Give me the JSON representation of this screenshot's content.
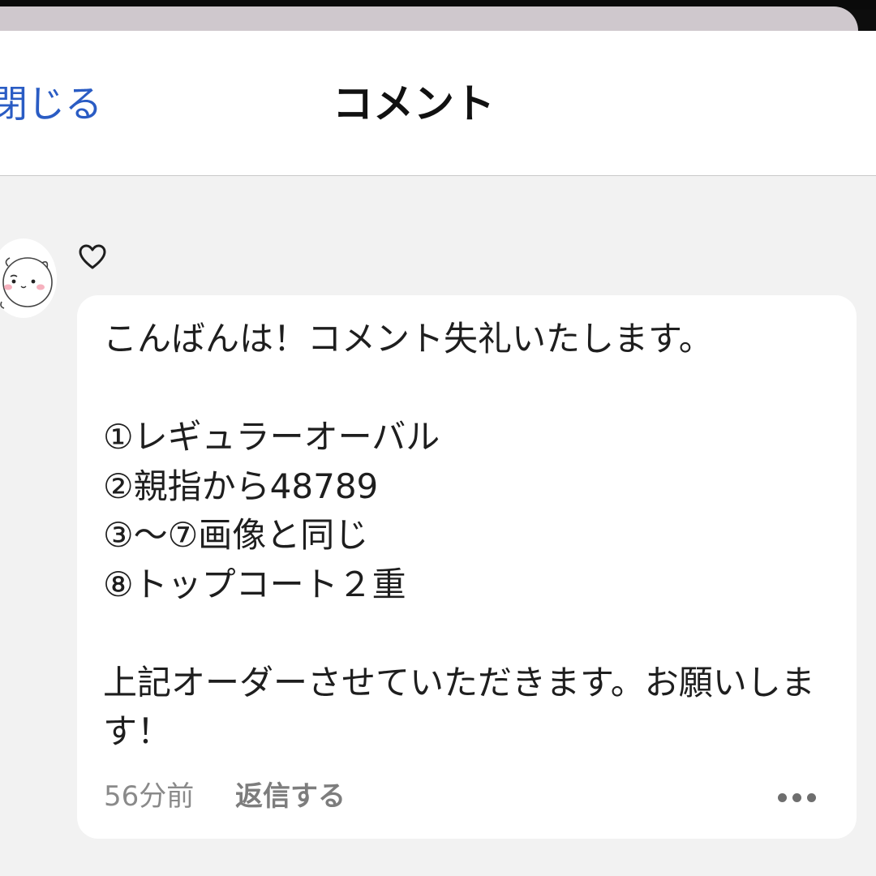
{
  "header": {
    "close_label": "閉じる",
    "title": "コメント"
  },
  "comment": {
    "avatar_icon": "hamster-avatar-icon",
    "like_icon": "heart-outline-icon",
    "text": "こんばんは！コメント失礼いたします。\n\n①レギュラーオーバル\n②親指から48789\n③〜⑦画像と同じ\n⑧トップコート２重\n\n上記オーダーさせていただきます。お願いします！",
    "time": "56分前",
    "reply_label": "返信する",
    "more_icon": "more-dots-icon"
  },
  "colors": {
    "link": "#2a5cc4",
    "sheet_background": "#f2f2f2",
    "bubble_background": "#ffffff",
    "secondary_text": "#8a8a8a"
  }
}
